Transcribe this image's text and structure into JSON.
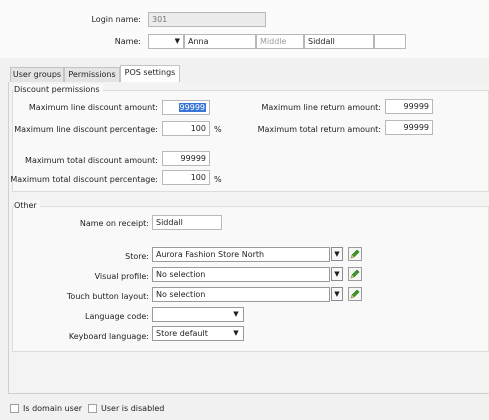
{
  "header": {
    "login_name_label": "Login name:",
    "login_name_value": "301",
    "name_label": "Name:",
    "first_name": "Anna",
    "middle_name_placeholder": "Middle",
    "last_name": "Siddall"
  },
  "tabs": [
    {
      "label": "User groups"
    },
    {
      "label": "Permissions"
    },
    {
      "label": "POS settings",
      "active": true
    }
  ],
  "discount": {
    "title": "Discount permissions",
    "max_line_discount_amount_label": "Maximum line discount amount:",
    "max_line_discount_amount_value": "99999",
    "max_line_discount_pct_label": "Maximum line discount percentage:",
    "max_line_discount_pct_value": "100",
    "max_total_discount_amount_label": "Maximum total discount amount:",
    "max_total_discount_amount_value": "99999",
    "max_total_discount_pct_label": "Maximum total discount percentage:",
    "max_total_discount_pct_value": "100",
    "max_line_return_amount_label": "Maximum line return amount:",
    "max_line_return_amount_value": "99999",
    "max_total_return_amount_label": "Maximum total return amount:",
    "max_total_return_amount_value": "99999",
    "percent_sign": "%"
  },
  "other": {
    "title": "Other",
    "name_on_receipt_label": "Name on receipt:",
    "name_on_receipt_value": "Siddall",
    "store_label": "Store:",
    "store_value": "Aurora Fashion Store North",
    "visual_profile_label": "Visual profile:",
    "visual_profile_value": "No selection",
    "touch_layout_label": "Touch button layout:",
    "touch_layout_value": "No selection",
    "language_code_label": "Language code:",
    "language_code_value": "",
    "keyboard_language_label": "Keyboard language:",
    "keyboard_language_value": "Store default"
  },
  "footer": {
    "is_domain_user_label": "Is domain user",
    "is_domain_user_checked": false,
    "user_disabled_label": "User is disabled",
    "user_disabled_checked": false
  },
  "colors": {
    "edit_pencil": "#3a9b2a",
    "selection": "#3875d7"
  },
  "icons": [
    "chevron-down-icon",
    "pencil-icon"
  ]
}
